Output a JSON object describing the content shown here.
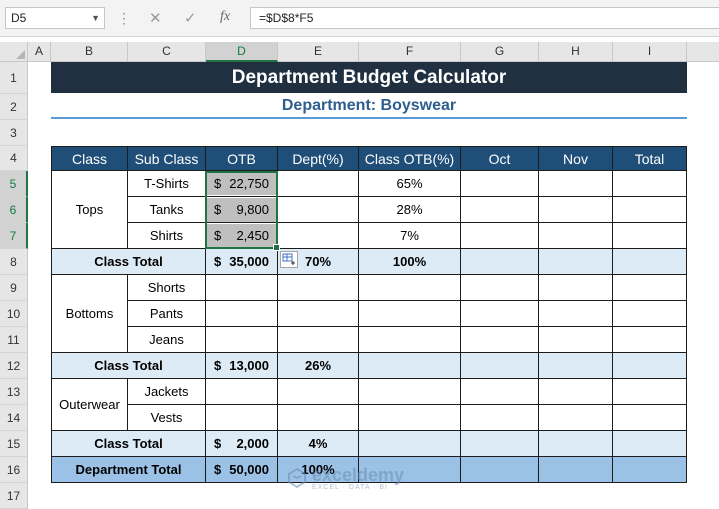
{
  "formula_bar": {
    "name_box": "D5",
    "formula": "=$D$8*F5"
  },
  "columns": [
    "A",
    "B",
    "C",
    "D",
    "E",
    "F",
    "G",
    "H",
    "I"
  ],
  "rows": [
    "1",
    "2",
    "3",
    "4",
    "5",
    "6",
    "7",
    "8",
    "9",
    "10",
    "11",
    "12",
    "13",
    "14",
    "15",
    "16",
    "17"
  ],
  "title": "Department Budget Calculator",
  "subtitle": "Department: Boyswear",
  "headers": [
    "Class",
    "Sub Class",
    "OTB",
    "Dept(%)",
    "Class OTB(%)",
    "Oct",
    "Nov",
    "Total"
  ],
  "groups": {
    "tops": {
      "class": "Tops",
      "subs": [
        "T-Shirts",
        "Tanks",
        "Shirts"
      ],
      "otb_sym": "$",
      "otb": [
        "22,750",
        "9,800",
        "2,450"
      ],
      "class_otb_pct": [
        "65%",
        "28%",
        "7%"
      ]
    },
    "bottoms": {
      "class": "Bottoms",
      "subs": [
        "Shorts",
        "Pants",
        "Jeans"
      ]
    },
    "outerwear": {
      "class": "Outerwear",
      "subs": [
        "Jackets",
        "Vests"
      ]
    }
  },
  "totals": {
    "tops": {
      "label": "Class Total",
      "sym": "$",
      "otb": "35,000",
      "dept_pct": "70%",
      "class_pct": "100%"
    },
    "bottoms": {
      "label": "Class Total",
      "sym": "$",
      "otb": "13,000",
      "dept_pct": "26%"
    },
    "outerwear": {
      "label": "Class Total",
      "sym": "$",
      "otb": "2,000",
      "dept_pct": "4%"
    },
    "department": {
      "label": "Department Total",
      "sym": "$",
      "otb": "50,000",
      "dept_pct": "100%"
    }
  },
  "watermark": {
    "name": "exceldemy",
    "tagline": "EXCEL · DATA · BI"
  },
  "colors": {
    "header_fill": "#1f4e78",
    "band_fill": "#ddebf7",
    "dept_total_fill": "#9bc2e6",
    "selection": "#217346"
  }
}
